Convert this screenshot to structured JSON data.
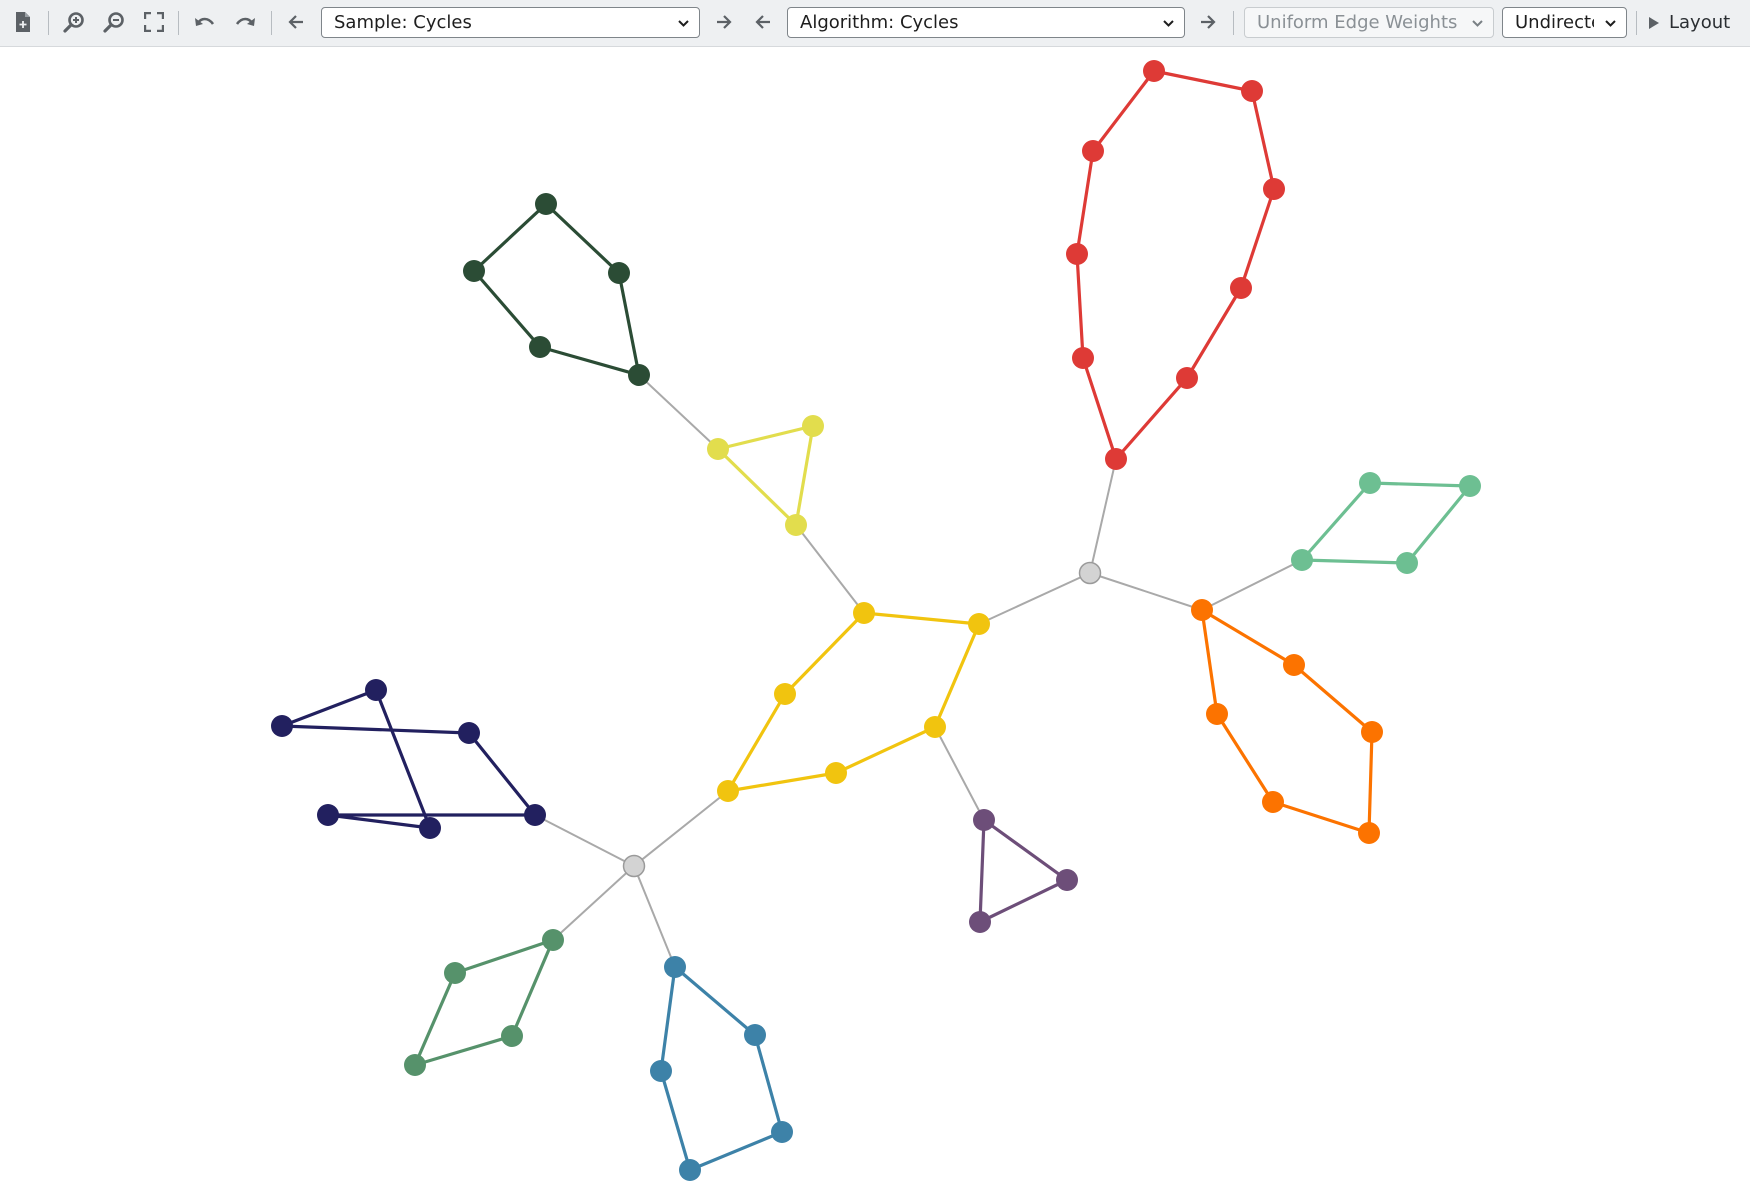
{
  "toolbar": {
    "buttons": [
      {
        "name": "new-document-icon"
      },
      {
        "name": "zoom-in-icon"
      },
      {
        "name": "zoom-out-icon"
      },
      {
        "name": "fit-content-icon"
      },
      {
        "name": "undo-icon"
      },
      {
        "name": "redo-icon"
      }
    ],
    "sample_select": {
      "value": "Sample: Cycles"
    },
    "algorithm_select": {
      "value": "Algorithm: Cycles"
    },
    "edge_weights_select": {
      "value": "Uniform Edge Weights",
      "disabled": true
    },
    "direction_select": {
      "value": "Undirected"
    },
    "layout_button": {
      "label": "Layout",
      "icon": "play-icon"
    }
  },
  "colors": {
    "toolbar_bg": "#eef0f2",
    "gray_edge": "#a9a9a9",
    "gray_node": "#d3d3d3",
    "yellow": "#f1c40f",
    "light_yellow": "#e2dd4d",
    "red": "#de3a36",
    "dark_green": "#2b4c35",
    "navy": "#22205f",
    "mint": "#6dbf92",
    "orange": "#fc7300",
    "purple": "#6d4e79",
    "sea_green": "#56926b",
    "steel_blue": "#3d82a8"
  },
  "graph": {
    "nodes": [
      {
        "id": "h1",
        "color": "gray_node",
        "outline": true
      },
      {
        "id": "h2",
        "color": "gray_node",
        "outline": true
      },
      {
        "id": "y1",
        "color": "yellow"
      },
      {
        "id": "y2",
        "color": "yellow"
      },
      {
        "id": "y3",
        "color": "yellow"
      },
      {
        "id": "y4",
        "color": "yellow"
      },
      {
        "id": "y5",
        "color": "yellow"
      },
      {
        "id": "y6",
        "color": "yellow"
      },
      {
        "id": "y7",
        "color": "yellow"
      },
      {
        "id": "ly1",
        "color": "light_yellow"
      },
      {
        "id": "ly2",
        "color": "light_yellow"
      },
      {
        "id": "ly3",
        "color": "light_yellow"
      },
      {
        "id": "dg1",
        "color": "dark_green"
      },
      {
        "id": "dg2",
        "color": "dark_green"
      },
      {
        "id": "dg3",
        "color": "dark_green"
      },
      {
        "id": "dg4",
        "color": "dark_green"
      },
      {
        "id": "dg5",
        "color": "dark_green"
      },
      {
        "id": "r1",
        "color": "red"
      },
      {
        "id": "r2",
        "color": "red"
      },
      {
        "id": "r3",
        "color": "red"
      },
      {
        "id": "r4",
        "color": "red"
      },
      {
        "id": "r5",
        "color": "red"
      },
      {
        "id": "r6",
        "color": "red"
      },
      {
        "id": "r7",
        "color": "red"
      },
      {
        "id": "r8",
        "color": "red"
      },
      {
        "id": "r9",
        "color": "red"
      },
      {
        "id": "m1",
        "color": "mint"
      },
      {
        "id": "m2",
        "color": "mint"
      },
      {
        "id": "m3",
        "color": "mint"
      },
      {
        "id": "m4",
        "color": "mint"
      },
      {
        "id": "o1",
        "color": "orange"
      },
      {
        "id": "o2",
        "color": "orange"
      },
      {
        "id": "o3",
        "color": "orange"
      },
      {
        "id": "o4",
        "color": "orange"
      },
      {
        "id": "o5",
        "color": "orange"
      },
      {
        "id": "o6",
        "color": "orange"
      },
      {
        "id": "p1",
        "color": "purple"
      },
      {
        "id": "p2",
        "color": "purple"
      },
      {
        "id": "p3",
        "color": "purple"
      },
      {
        "id": "n1",
        "color": "navy"
      },
      {
        "id": "n2",
        "color": "navy"
      },
      {
        "id": "n3",
        "color": "navy"
      },
      {
        "id": "n4",
        "color": "navy"
      },
      {
        "id": "n5",
        "color": "navy"
      },
      {
        "id": "n6",
        "color": "navy"
      },
      {
        "id": "g1",
        "color": "sea_green"
      },
      {
        "id": "g2",
        "color": "sea_green"
      },
      {
        "id": "g3",
        "color": "sea_green"
      },
      {
        "id": "g4",
        "color": "sea_green"
      },
      {
        "id": "b1",
        "color": "steel_blue"
      },
      {
        "id": "b2",
        "color": "steel_blue"
      },
      {
        "id": "b3",
        "color": "steel_blue"
      },
      {
        "id": "b4",
        "color": "steel_blue"
      },
      {
        "id": "b5",
        "color": "steel_blue"
      }
    ],
    "edges": [
      [
        "h1",
        "r1",
        "gray_edge"
      ],
      [
        "h1",
        "y2",
        "gray_edge"
      ],
      [
        "h1",
        "o1",
        "gray_edge"
      ],
      [
        "y1",
        "ly3",
        "gray_edge"
      ],
      [
        "ly1",
        "dg5",
        "gray_edge"
      ],
      [
        "y3",
        "p1",
        "gray_edge"
      ],
      [
        "y5",
        "h2",
        "gray_edge"
      ],
      [
        "o1",
        "m3",
        "gray_edge"
      ],
      [
        "h2",
        "n5",
        "gray_edge"
      ],
      [
        "h2",
        "g1",
        "gray_edge"
      ],
      [
        "h2",
        "b1",
        "gray_edge"
      ],
      [
        "y1",
        "y2",
        "yellow"
      ],
      [
        "y2",
        "y3",
        "yellow"
      ],
      [
        "y3",
        "y4",
        "yellow"
      ],
      [
        "y4",
        "y5",
        "yellow"
      ],
      [
        "y5",
        "y6",
        "yellow"
      ],
      [
        "y6",
        "y1",
        "yellow"
      ],
      [
        "ly1",
        "ly2",
        "light_yellow"
      ],
      [
        "ly2",
        "ly3",
        "light_yellow"
      ],
      [
        "ly3",
        "ly1",
        "light_yellow"
      ],
      [
        "dg1",
        "dg2",
        "dark_green"
      ],
      [
        "dg2",
        "dg5",
        "dark_green"
      ],
      [
        "dg5",
        "dg4",
        "dark_green"
      ],
      [
        "dg4",
        "dg3",
        "dark_green"
      ],
      [
        "dg3",
        "dg1",
        "dark_green"
      ],
      [
        "r1",
        "r2",
        "red"
      ],
      [
        "r2",
        "r3",
        "red"
      ],
      [
        "r3",
        "r4",
        "red"
      ],
      [
        "r4",
        "r5",
        "red"
      ],
      [
        "r5",
        "r6",
        "red"
      ],
      [
        "r6",
        "r7",
        "red"
      ],
      [
        "r7",
        "r8",
        "red"
      ],
      [
        "r8",
        "r9",
        "red"
      ],
      [
        "r9",
        "r1",
        "red"
      ],
      [
        "m1",
        "m2",
        "mint"
      ],
      [
        "m2",
        "m4",
        "mint"
      ],
      [
        "m4",
        "m3",
        "mint"
      ],
      [
        "m3",
        "m1",
        "mint"
      ],
      [
        "o1",
        "o2",
        "orange"
      ],
      [
        "o2",
        "o3",
        "orange"
      ],
      [
        "o3",
        "o6",
        "orange"
      ],
      [
        "o6",
        "o5",
        "orange"
      ],
      [
        "o5",
        "o4",
        "orange"
      ],
      [
        "o4",
        "o1",
        "orange"
      ],
      [
        "p1",
        "p2",
        "purple"
      ],
      [
        "p2",
        "p3",
        "purple"
      ],
      [
        "p3",
        "p1",
        "purple"
      ],
      [
        "n1",
        "n2",
        "navy"
      ],
      [
        "n2",
        "n3",
        "navy"
      ],
      [
        "n3",
        "n5",
        "navy"
      ],
      [
        "n5",
        "n4",
        "navy"
      ],
      [
        "n4",
        "n6",
        "navy"
      ],
      [
        "n6",
        "n1",
        "navy"
      ],
      [
        "g1",
        "g2",
        "sea_green"
      ],
      [
        "g2",
        "g4",
        "sea_green"
      ],
      [
        "g4",
        "g3",
        "sea_green"
      ],
      [
        "g3",
        "g1",
        "sea_green"
      ],
      [
        "b1",
        "b2",
        "steel_blue"
      ],
      [
        "b2",
        "b4",
        "steel_blue"
      ],
      [
        "b4",
        "b5",
        "steel_blue"
      ],
      [
        "b5",
        "b3",
        "steel_blue"
      ],
      [
        "b3",
        "b1",
        "steel_blue"
      ]
    ]
  }
}
